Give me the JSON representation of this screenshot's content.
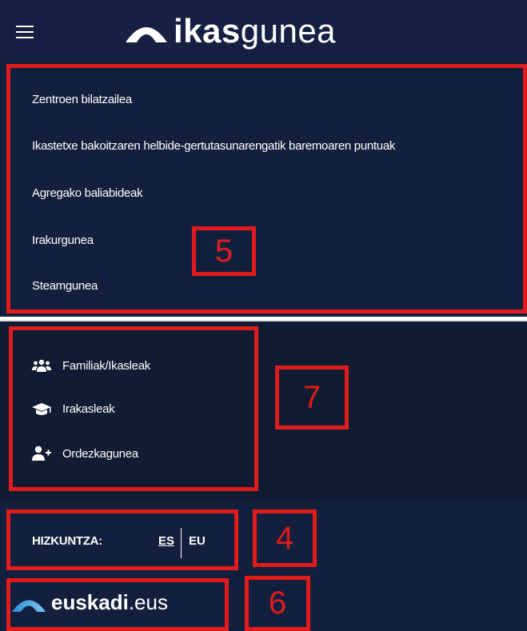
{
  "header": {
    "logo_bold": "ikas",
    "logo_light": "gunea"
  },
  "menu_links": [
    "Zentroen bilatzailea",
    "Ikastetxe bakoitzaren helbide-gertutasunarengatik baremoaren puntuak",
    "Agregako baliabideak",
    "Irakurgunea",
    "Steamgunea"
  ],
  "profiles": [
    {
      "label": "Familiak/Ikasleak",
      "icon": "users-icon"
    },
    {
      "label": "Irakasleak",
      "icon": "graduation-cap-icon"
    },
    {
      "label": "Ordezkagunea",
      "icon": "user-plus-icon"
    }
  ],
  "language": {
    "label": "HIZKUNTZA:",
    "options": [
      "ES",
      "EU"
    ],
    "selected": "ES"
  },
  "footer": {
    "logo_bold": "euskadi",
    "logo_light": ".eus"
  },
  "annotations": [
    "5",
    "7",
    "4",
    "6"
  ],
  "colors": {
    "header_bg": "#152042",
    "panel_bg": "#13203d",
    "profiles_bg": "#0f1c31",
    "annotation_red": "#e01b1b"
  }
}
